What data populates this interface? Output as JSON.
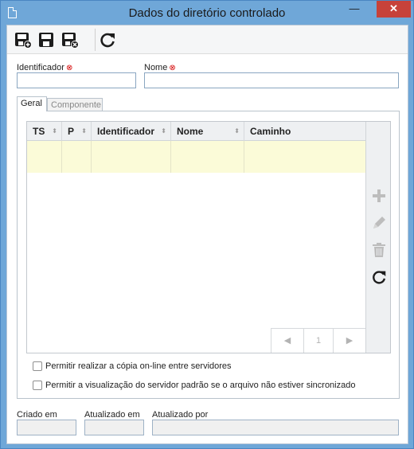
{
  "window": {
    "title": "Dados do diretório controlado",
    "min_glyph": "—",
    "max_glyph": "☐",
    "close_glyph": "✕"
  },
  "toolbar": {
    "buttons": [
      {
        "name": "save-new-icon"
      },
      {
        "name": "save-icon"
      },
      {
        "name": "save-close-icon"
      },
      {
        "name": "refresh-icon"
      }
    ]
  },
  "form": {
    "identificador": {
      "label": "Identificador",
      "required_mark": "⊗",
      "value": ""
    },
    "nome": {
      "label": "Nome",
      "required_mark": "⊗",
      "value": ""
    }
  },
  "tabs": [
    {
      "label": "Geral",
      "active": true
    },
    {
      "label": "Componente",
      "active": false
    }
  ],
  "grid": {
    "columns": [
      {
        "label": "TS",
        "sortable": true
      },
      {
        "label": "P",
        "sortable": true
      },
      {
        "label": "Identificador",
        "sortable": true
      },
      {
        "label": "Nome",
        "sortable": true
      },
      {
        "label": "Caminho",
        "sortable": false
      }
    ],
    "sort_glyph": "⬍",
    "rows": [
      [
        "",
        "",
        "",
        "",
        ""
      ]
    ],
    "pager": {
      "prev": "◀",
      "page": "1",
      "next": "▶"
    },
    "side_tools": [
      "add-icon",
      "edit-icon",
      "delete-icon",
      "refresh-icon"
    ]
  },
  "options": [
    {
      "label": "Permitir realizar a cópia on-line entre servidores",
      "checked": false
    },
    {
      "label": "Permitir a visualização do servidor padrão se o arquivo não estiver sincronizado",
      "checked": false
    }
  ],
  "footer": {
    "criado_em": {
      "label": "Criado em",
      "value": ""
    },
    "atualizado_em": {
      "label": "Atualizado em",
      "value": ""
    },
    "atualizado_por": {
      "label": "Atualizado por",
      "value": ""
    }
  },
  "colors": {
    "titlebar": "#6fa7d8",
    "close_button": "#c7423a",
    "selected_row": "#fbfbd8",
    "required_mark": "#d40000"
  }
}
